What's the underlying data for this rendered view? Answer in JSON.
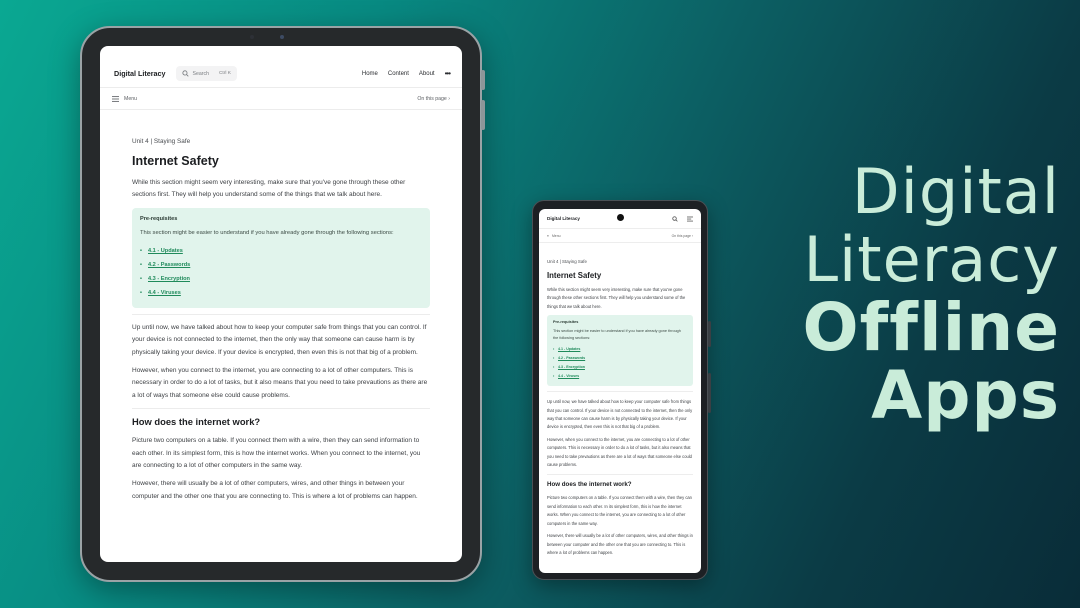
{
  "headline": {
    "line1": "Digital",
    "line2": "Literacy",
    "line3": "Offline",
    "line4": "Apps",
    "color": "#c9ecd9"
  },
  "tablet": {
    "brand": "Digital Literacy",
    "search_placeholder": "Search",
    "search_shortcut": "Ctrl K",
    "nav": [
      "Home",
      "Content",
      "About"
    ],
    "more_icon": "more-horizontal-icon",
    "menu_label": "Menu",
    "on_this_page": "On this page",
    "unit": "Unit 4 | Staying Safe",
    "title": "Internet Safety",
    "intro": "While this section might seem very interesting, make sure that you've gone through these other sections first. They will help you understand some of the things that we talk about here.",
    "prereq_title": "Pre-requisites",
    "prereq_text": "This section might be easier to understand if you have already gone through the following sections:",
    "prereqs": [
      "4.1 - Updates",
      "4.2 - Passwords",
      "4.3 - Encryption",
      "4.4 - Viruses"
    ],
    "para1": "Up until now, we have talked about how to keep your computer safe from things that you can control. If your device is not connected to the internet, then the only way that someone can cause harm is by physically taking your device. If your device is encrypted, then even this is not that big of a problem.",
    "para2": "However, when you connect to the internet, you are connecting to a lot of other computers. This is necessary in order to do a lot of tasks, but it also means that you need to take prevautions as there are a lot of ways that someone else could cause problems.",
    "h2": "How does the internet work?",
    "para3": "Picture two computers on a table. If you connect them with a wire, then they can send information to each other. In its simplest form, this is how the internet works. When you connect to the internet, you are connecting to a lot of other computers in the same way.",
    "para4": "However, there will usually be a lot of other computers, wires, and other things in between your computer and the other one that you are connecting to. This is where a lot of problems can happen.",
    "accent": "#1f8a5b",
    "callout_bg": "#e1f4ec"
  },
  "phone": {
    "brand": "Digital Literacy",
    "menu_label": "Menu",
    "on_this_page": "On this page",
    "unit": "Unit 4 | Staying Safe",
    "title": "Internet Safety",
    "intro": "While this section might seem very interesting, make sure that you've gone through these other sections first. They will help you understand some of the things that we talk about here.",
    "prereq_title": "Pre-requisites",
    "prereq_text": "This section might be easier to understand if you have already gone through the following sections:",
    "prereqs": [
      "4.1 - Updates",
      "4.2 - Passwords",
      "4.3 - Encryption",
      "4.4 - Viruses"
    ],
    "para1": "Up until now, we have talked about how to keep your computer safe from things that you can control. If your device is not connected to the internet, then the only way that someone can cause harm is by physically taking your device. If your device is encrypted, then even this is not that big of a problem.",
    "para2": "However, when you connect to the internet, you are connecting to a lot of other computers. This is necessary in order to do a lot of tasks, but it also means that you need to take prevautions as there are a lot of ways that someone else could cause problems.",
    "h2": "How does the internet work?",
    "para3": "Picture two computers on a table. If you connect them with a wire, then they can send information to each other. In its simplest form, this is how the internet works. When you connect to the internet, you are connecting to a lot of other computers in the same way.",
    "para4": "However, there will usually be a lot of other computers, wires, and other things in between your computer and the other one that you are connecting to. This is where a lot of problems can happen."
  }
}
